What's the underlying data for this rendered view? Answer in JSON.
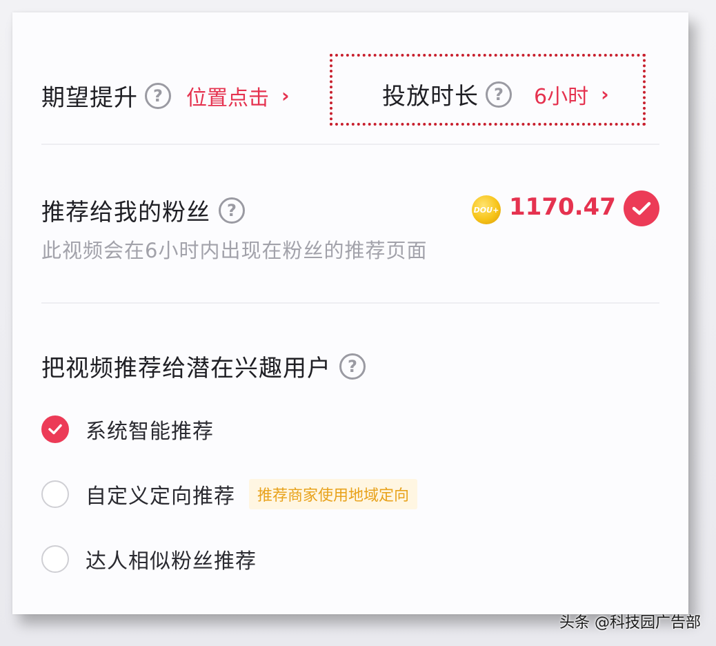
{
  "boost": {
    "goal_label": "期望提升",
    "goal_value": "位置点击",
    "duration_label": "投放时长",
    "duration_value": "6小时",
    "chevron": "›"
  },
  "fans": {
    "title": "推荐给我的粉丝",
    "description": "此视频会在6小时内出现在粉丝的推荐页面",
    "price": "1170.47",
    "coin_text": "DOU+",
    "checked": true
  },
  "interest": {
    "title": "把视频推荐给潜在兴趣用户",
    "options": [
      {
        "label": "系统智能推荐",
        "checked": true
      },
      {
        "label": "自定义定向推荐",
        "checked": false,
        "tag": "推荐商家使用地域定向"
      },
      {
        "label": "达人相似粉丝推荐",
        "checked": false
      }
    ]
  },
  "help_glyph": "?",
  "watermark": "头条 @科技园广告部",
  "colors": {
    "accent": "#ec3b57",
    "accent_text": "#e5324f",
    "tag_bg": "#fff6e2",
    "tag_text": "#e8a21b"
  },
  "icons": [
    "help-circle-icon",
    "chevron-right-icon",
    "coin-icon",
    "check-icon"
  ]
}
